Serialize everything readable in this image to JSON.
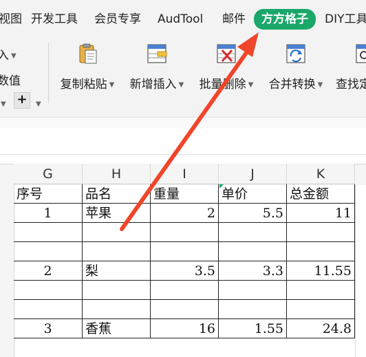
{
  "tabs": [
    {
      "name": "tab-view",
      "label": "视图"
    },
    {
      "name": "tab-developer",
      "label": "开发工具"
    },
    {
      "name": "tab-member",
      "label": "会员专享"
    },
    {
      "name": "tab-audtool",
      "label": "AudTool"
    },
    {
      "name": "tab-mail",
      "label": "邮件"
    },
    {
      "name": "tab-fangfang",
      "label": "方方格子"
    },
    {
      "name": "tab-diy",
      "label": "DIY工具"
    }
  ],
  "ribbon": {
    "left_top": "入",
    "left_mid": "数值",
    "plus": "+",
    "buttons": [
      {
        "label": "复制粘贴",
        "icon": "clipboard-paste-icon"
      },
      {
        "label": "新增插入",
        "icon": "insert-row-icon"
      },
      {
        "label": "批量删除",
        "icon": "batch-delete-icon"
      },
      {
        "label": "合并转换",
        "icon": "merge-convert-icon"
      },
      {
        "label": "查找定",
        "icon": "find-locate-icon"
      }
    ]
  },
  "grid": {
    "columns": [
      "G",
      "H",
      "I",
      "J",
      "K"
    ],
    "header": [
      "序号",
      "品名",
      "重量",
      "单价",
      "总金额"
    ],
    "rows": [
      [
        "1",
        "苹果",
        "2",
        "5.5",
        "11"
      ],
      [
        "",
        "",
        "",
        "",
        ""
      ],
      [
        "",
        "",
        "",
        "",
        ""
      ],
      [
        "2",
        "梨",
        "3.5",
        "3.3",
        "11.55"
      ],
      [
        "",
        "",
        "",
        "",
        ""
      ],
      [
        "",
        "",
        "",
        "",
        ""
      ],
      [
        "3",
        "香蕉",
        "16",
        "1.55",
        "24.8"
      ]
    ]
  },
  "colors": {
    "accent": "#1aa86a",
    "arrow": "#f0452a"
  }
}
